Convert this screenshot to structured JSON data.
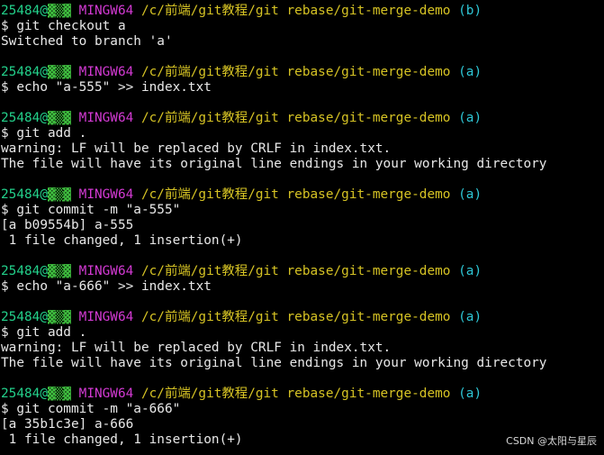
{
  "terminal": {
    "user": "25484@",
    "host_mask": "▓▒▓",
    "system": "MINGW64",
    "path": "/c/前端/git教程/git rebase/git-merge-demo",
    "blocks": [
      {
        "branch": "(b)",
        "command": "$ git checkout a",
        "output": [
          "Switched to branch 'a'"
        ]
      },
      {
        "branch": "(a)",
        "command": "$ echo \"a-555\" >> index.txt",
        "output": []
      },
      {
        "branch": "(a)",
        "command": "$ git add .",
        "output": [
          "warning: LF will be replaced by CRLF in index.txt.",
          "The file will have its original line endings in your working directory"
        ]
      },
      {
        "branch": "(a)",
        "command": "$ git commit -m \"a-555\"",
        "output": [
          "[a b09554b] a-555",
          " 1 file changed, 1 insertion(+)"
        ]
      },
      {
        "branch": "(a)",
        "command": "$ echo \"a-666\" >> index.txt",
        "output": []
      },
      {
        "branch": "(a)",
        "command": "$ git add .",
        "output": [
          "warning: LF will be replaced by CRLF in index.txt.",
          "The file will have its original line endings in your working directory"
        ]
      },
      {
        "branch": "(a)",
        "command": "$ git commit -m \"a-666\"",
        "output": [
          "[a 35b1c3e] a-666",
          " 1 file changed, 1 insertion(+)"
        ]
      }
    ]
  },
  "watermark": "CSDN @太阳与星辰"
}
